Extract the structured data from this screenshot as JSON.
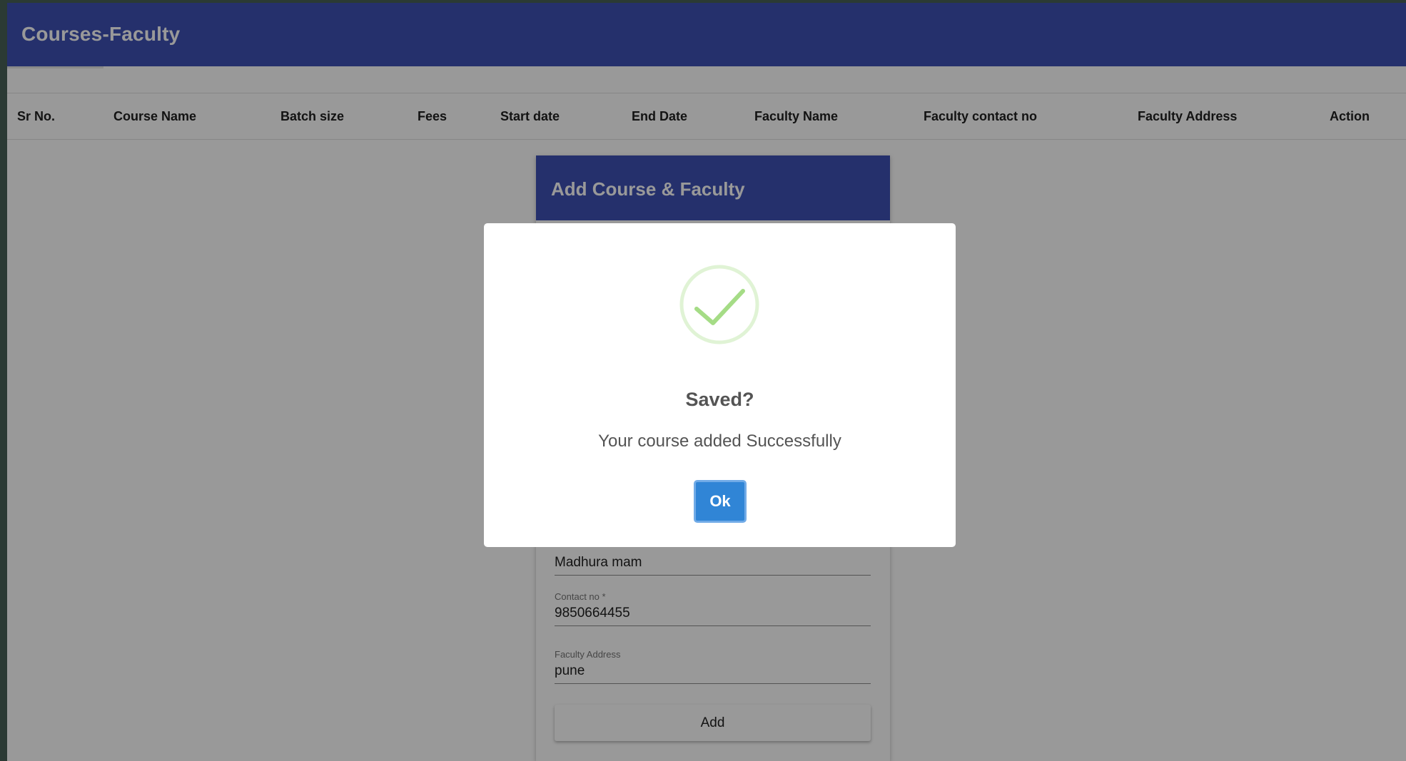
{
  "toolbar": {
    "title": "Courses-Faculty"
  },
  "table": {
    "columns": [
      "Sr No.",
      "Course Name",
      "Batch size",
      "Fees",
      "Start date",
      "End Date",
      "Faculty Name",
      "Faculty contact no",
      "Faculty Address",
      "Action"
    ]
  },
  "form": {
    "title": "Add Course & Faculty",
    "faculty_name": {
      "value": "Madhura mam"
    },
    "contact_no": {
      "label": "Contact no *",
      "value": "9850664455"
    },
    "faculty_address": {
      "label": "Faculty Address",
      "value": "pune"
    },
    "add_label": "Add"
  },
  "dialog": {
    "icon": "success-check-icon",
    "title": "Saved?",
    "text": "Your course added Successfully",
    "ok_label": "Ok"
  },
  "colors": {
    "primary": "#3f51b5",
    "confirm_button": "#3085d6",
    "success": "#a5dc86"
  }
}
